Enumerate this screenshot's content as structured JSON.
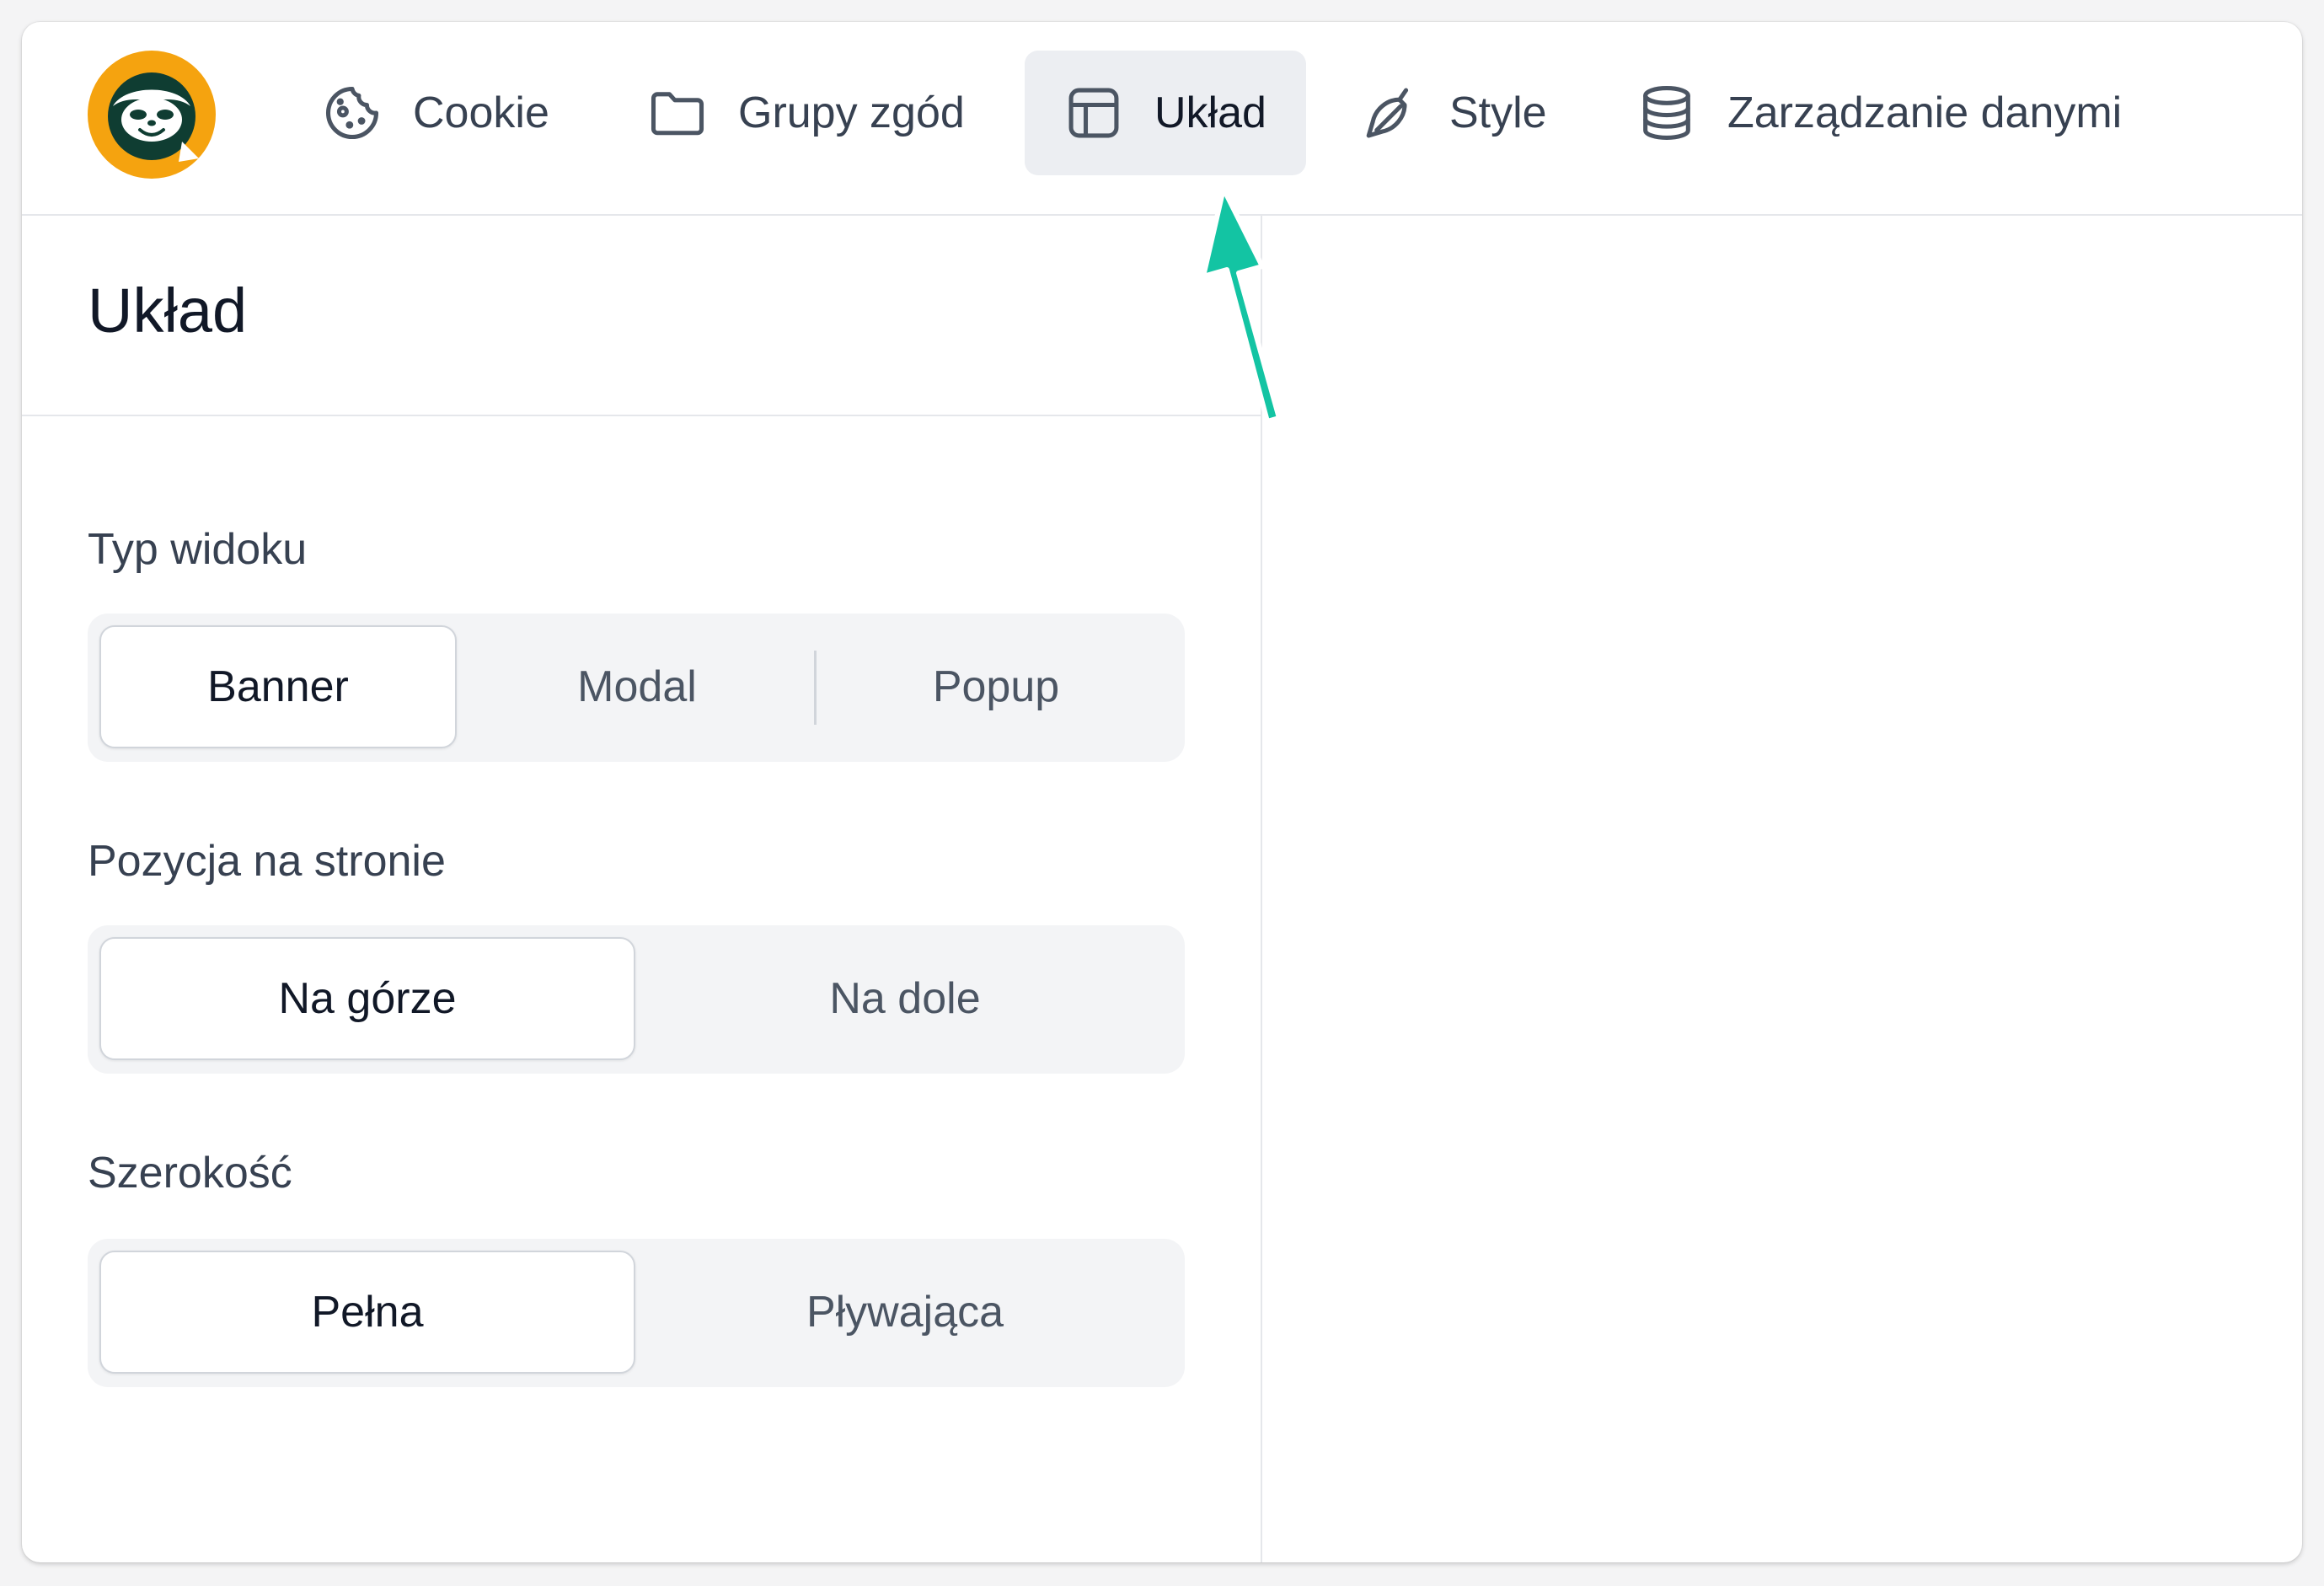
{
  "nav": {
    "tabs": [
      {
        "label": "Cookie",
        "icon": "cookie-icon"
      },
      {
        "label": "Grupy zgód",
        "icon": "folder-icon"
      },
      {
        "label": "Układ",
        "icon": "layout-icon",
        "active": true
      },
      {
        "label": "Style",
        "icon": "brush-icon"
      },
      {
        "label": "Zarządzanie danymi",
        "icon": "database-icon"
      }
    ]
  },
  "panel": {
    "title": "Układ",
    "sections": [
      {
        "label": "Typ widoku",
        "options": [
          "Banner",
          "Modal",
          "Popup"
        ],
        "selected": "Banner"
      },
      {
        "label": "Pozycja na stronie",
        "options": [
          "Na górze",
          "Na dole"
        ],
        "selected": "Na górze"
      },
      {
        "label": "Szerokość",
        "options": [
          "Pełna",
          "Pływająca"
        ],
        "selected": "Pełna"
      }
    ]
  },
  "colors": {
    "logo_bg": "#f5a30f",
    "logo_dark": "#0f3d32",
    "annotation_arrow": "#13c4a3",
    "active_tab_bg": "#eceef2"
  }
}
